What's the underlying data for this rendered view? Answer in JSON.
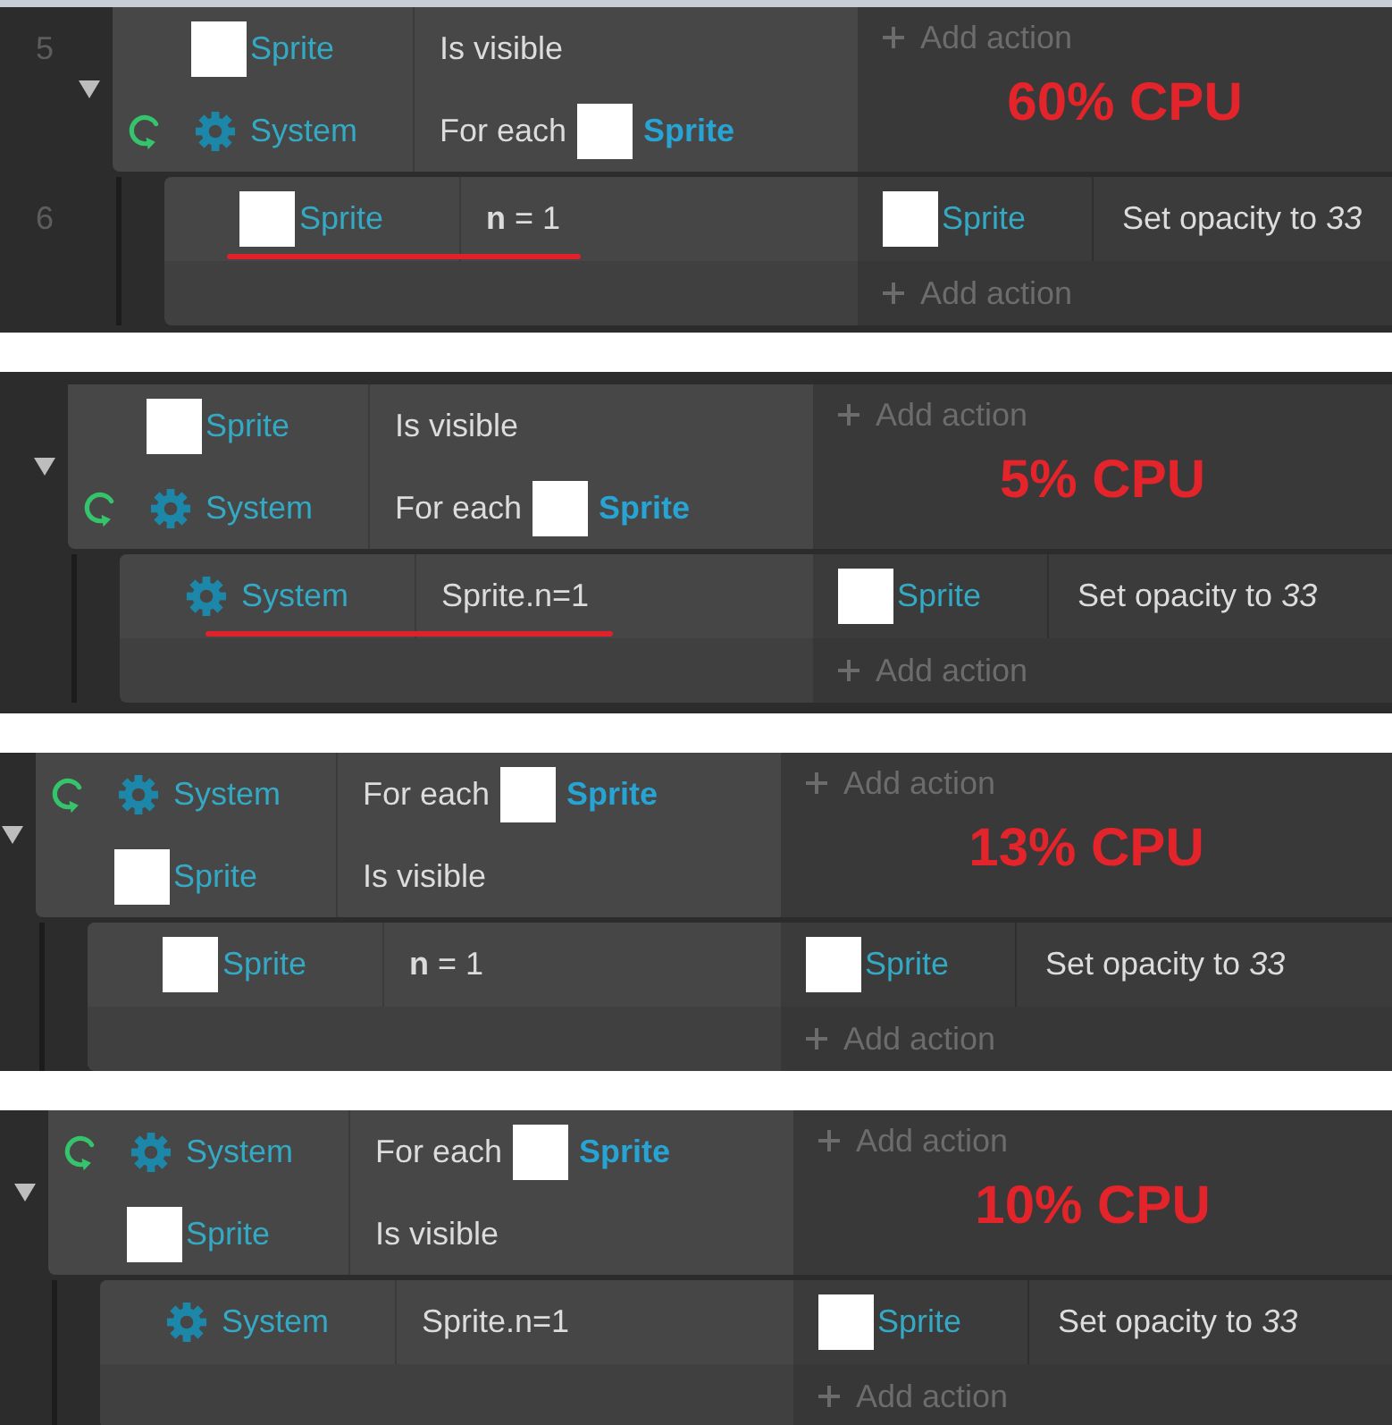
{
  "panels": [
    {
      "parent": {
        "line_number": "5",
        "expanded": true,
        "conditions": [
          {
            "kind": "object",
            "object": "Sprite",
            "loop": false,
            "text": "Is visible"
          },
          {
            "kind": "system",
            "object": "System",
            "loop": true,
            "text": "For each",
            "param": "Sprite"
          }
        ],
        "add_action": "Add action",
        "annotation": "60% CPU"
      },
      "sub_event": {
        "line_number": "6",
        "conditions": [
          {
            "kind": "object",
            "object": "Sprite",
            "loop": false,
            "text": "**n** = 1",
            "underlined": true
          }
        ],
        "actions": [
          {
            "kind": "object",
            "object": "Sprite",
            "text": "Set opacity to *33*"
          }
        ],
        "add_action": "Add action"
      }
    },
    {
      "parent": {
        "expanded": true,
        "conditions": [
          {
            "kind": "object",
            "object": "Sprite",
            "loop": false,
            "text": "Is visible"
          },
          {
            "kind": "system",
            "object": "System",
            "loop": true,
            "text": "For each",
            "param": "Sprite"
          }
        ],
        "add_action": "Add action",
        "annotation": "5% CPU"
      },
      "sub_event": {
        "conditions": [
          {
            "kind": "system",
            "object": "System",
            "loop": false,
            "text": "Sprite.n=1",
            "underlined": true
          }
        ],
        "actions": [
          {
            "kind": "object",
            "object": "Sprite",
            "text": "Set opacity to *33*"
          }
        ],
        "add_action": "Add action"
      }
    },
    {
      "parent": {
        "expanded": true,
        "conditions": [
          {
            "kind": "system",
            "object": "System",
            "loop": true,
            "text": "For each",
            "param": "Sprite"
          },
          {
            "kind": "object",
            "object": "Sprite",
            "loop": false,
            "text": "Is visible"
          }
        ],
        "add_action": "Add action",
        "annotation": "13% CPU"
      },
      "sub_event": {
        "conditions": [
          {
            "kind": "object",
            "object": "Sprite",
            "loop": false,
            "text": "**n** = 1",
            "underlined": false
          }
        ],
        "actions": [
          {
            "kind": "object",
            "object": "Sprite",
            "text": "Set opacity to *33*"
          }
        ],
        "add_action": "Add action"
      }
    },
    {
      "parent": {
        "expanded": true,
        "conditions": [
          {
            "kind": "system",
            "object": "System",
            "loop": true,
            "text": "For each",
            "param": "Sprite"
          },
          {
            "kind": "object",
            "object": "Sprite",
            "loop": false,
            "text": "Is visible"
          }
        ],
        "add_action": "Add action",
        "annotation": "10% CPU"
      },
      "sub_event": {
        "conditions": [
          {
            "kind": "system",
            "object": "System",
            "loop": false,
            "text": "Sprite.n=1",
            "underlined": false
          }
        ],
        "actions": [
          {
            "kind": "object",
            "object": "Sprite",
            "text": "Set opacity to *33*"
          }
        ],
        "add_action": "Add action"
      }
    }
  ]
}
